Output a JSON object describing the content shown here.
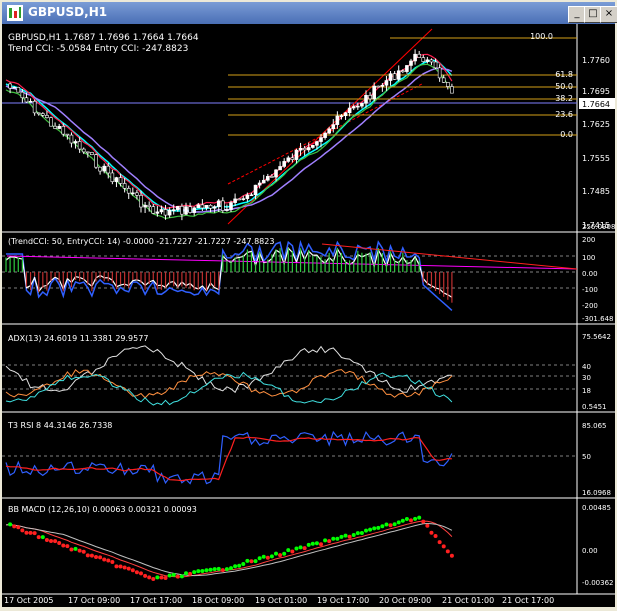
{
  "window": {
    "title": "GBPUSD,H1",
    "buttons": [
      "_",
      "□",
      "×"
    ]
  },
  "main": {
    "header": "GBPUSD,H1  1.7687 1.7696 1.7664 1.7664",
    "subheader": "Trend CCI: -5.0584 Entry CCI: -247.8823",
    "price_ticks": [
      "1.7760",
      "1.7695",
      "1.7625",
      "1.7555",
      "1.7485",
      "1.7415"
    ],
    "current_price": "1.7664",
    "fib_labels": [
      "100.0",
      "61.8",
      "50.0",
      "38.2",
      "23.6",
      "0.0"
    ]
  },
  "cci": {
    "label": "(TrendCCI: 50, EntryCCI: 14) -0.0000 -21.7227 -21.7227 -247.8823",
    "ticks": [
      "256.0908",
      "200",
      "100",
      "0.00",
      "-100",
      "-200",
      "-301.648"
    ]
  },
  "adx": {
    "label": "ADX(13) 24.6019 11.3381 29.9577",
    "ticks": [
      "75.5642",
      "40",
      "30",
      "18",
      "0.5451"
    ]
  },
  "rsi": {
    "label": "T3 RSI 8 44.3146 26.7338",
    "ticks": [
      "85.065",
      "50",
      "16.0968"
    ]
  },
  "macd": {
    "label": "BB MACD (12,26,10) 0.00063 0.00321 0.00093",
    "ticks": [
      "0.00485",
      "0.00",
      "-0.00362"
    ]
  },
  "time_axis": [
    "17 Oct 2005",
    "17 Oct 09:00",
    "17 Oct 17:00",
    "18 Oct 09:00",
    "19 Oct 01:00",
    "19 Oct 17:00",
    "20 Oct 09:00",
    "21 Oct 01:00",
    "21 Oct 17:00"
  ],
  "colors": {
    "bg": "#000000",
    "grid": "#808080",
    "fib": "#d4a017",
    "bull": "#00ff00",
    "bear": "#ff0000"
  }
}
